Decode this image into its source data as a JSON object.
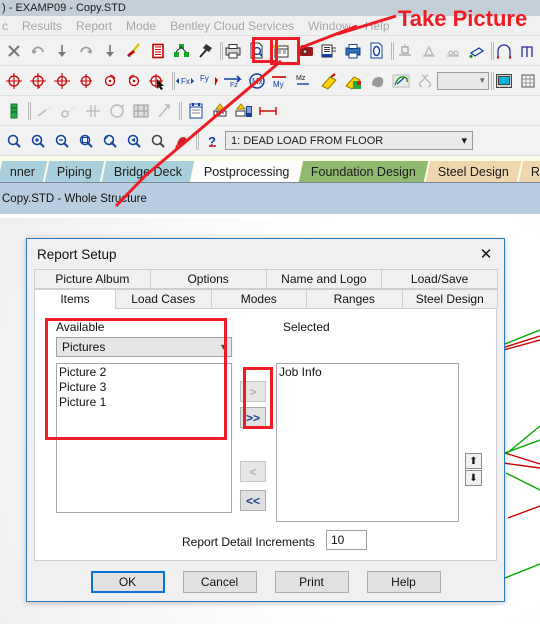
{
  "window": {
    "title": ") - EXAMP09 - Copy.STD"
  },
  "menubar": {
    "items": [
      {
        "label": "c"
      },
      {
        "label": "Results"
      },
      {
        "label": "Report"
      },
      {
        "label": "Mode"
      },
      {
        "label": "Bentley Cloud Services"
      },
      {
        "label": "Window"
      },
      {
        "label": "Help"
      }
    ]
  },
  "toolbar": {
    "load_case_combo": {
      "value": "1: DEAD LOAD FROM FLOOR",
      "arrow": "chevron-down-icon"
    },
    "empty_combo": {
      "value": "",
      "arrow": "chevron-down-icon"
    }
  },
  "page_tabs": [
    {
      "label": "nner",
      "style": "blue"
    },
    {
      "label": "Piping",
      "style": "blue"
    },
    {
      "label": "Bridge Deck",
      "style": "blue"
    },
    {
      "label": "Postprocessing",
      "style": "white"
    },
    {
      "label": "Foundation Design",
      "style": "green"
    },
    {
      "label": "Steel Design",
      "style": "tan"
    },
    {
      "label": "RAM Co",
      "style": "tan"
    }
  ],
  "status": {
    "text": "Copy.STD - Whole Structure"
  },
  "dialog": {
    "title": "Report Setup",
    "close_label": "✕",
    "tabs_row1": [
      {
        "label": "Picture Album",
        "active": false
      },
      {
        "label": "Options",
        "active": false
      },
      {
        "label": "Name and Logo",
        "active": false
      },
      {
        "label": "Load/Save",
        "active": false
      }
    ],
    "tabs_row2": [
      {
        "label": "Items",
        "active": true
      },
      {
        "label": "Load Cases",
        "active": false
      },
      {
        "label": "Modes",
        "active": false
      },
      {
        "label": "Ranges",
        "active": false
      },
      {
        "label": "Steel Design",
        "active": false
      }
    ],
    "available": {
      "label": "Available",
      "combo_value": "Pictures",
      "items": [
        "Picture 2",
        "Picture 3",
        "Picture 1"
      ]
    },
    "selected": {
      "label": "Selected",
      "items": [
        "Job Info"
      ]
    },
    "move_buttons": {
      "add_one": ">",
      "add_all": ">>",
      "remove_one": "<",
      "remove_all": "<<"
    },
    "order_buttons": {
      "up": "⬆",
      "down": "⬇"
    },
    "detail": {
      "label": "Report Detail Increments",
      "value": "10"
    },
    "buttons": [
      {
        "label": "OK",
        "focus": true
      },
      {
        "label": "Cancel",
        "focus": false
      },
      {
        "label": "Print",
        "focus": false
      },
      {
        "label": "Help",
        "focus": false
      }
    ]
  },
  "annotations": {
    "take_picture_label": "Take Picture",
    "color": "#ee1c25"
  }
}
